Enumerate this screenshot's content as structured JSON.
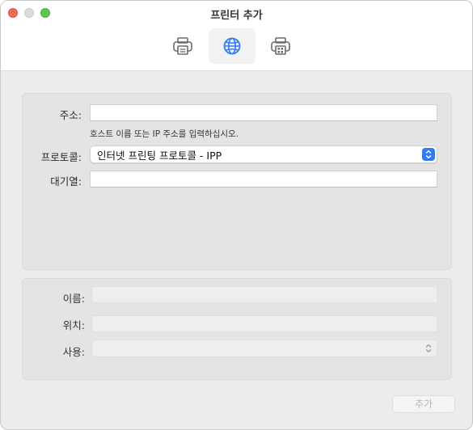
{
  "window": {
    "title": "프린터 추가"
  },
  "toolbar": {
    "items": [
      {
        "icon": "printer-icon",
        "selected": false
      },
      {
        "icon": "globe-icon",
        "selected": true
      },
      {
        "icon": "windows-printer-icon",
        "selected": false
      }
    ]
  },
  "form": {
    "address_label": "주소:",
    "address_value": "",
    "address_hint": "호스트 이름 또는 IP 주소를 입력하십시오.",
    "protocol_label": "프로토콜:",
    "protocol_value": "인터넷 프린팅 프로토콜 - IPP",
    "queue_label": "대기열:",
    "queue_value": ""
  },
  "details": {
    "name_label": "이름:",
    "name_value": "",
    "location_label": "위치:",
    "location_value": "",
    "use_label": "사용:",
    "use_value": ""
  },
  "footer": {
    "add_label": "추가"
  },
  "colors": {
    "accent": "#2f7cf6",
    "close": "#ed6a5e",
    "zoom": "#61c454"
  }
}
